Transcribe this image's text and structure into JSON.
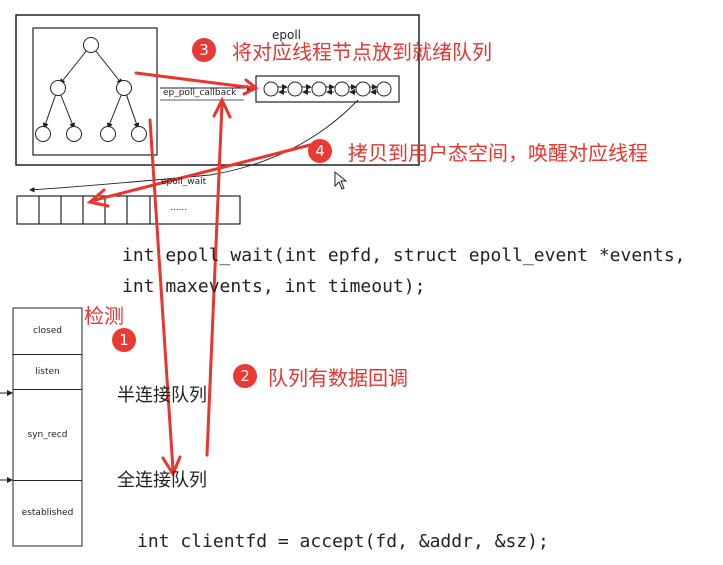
{
  "epoll_diagram": {
    "title": "epoll",
    "callback_label": "ep_poll_callback",
    "wait_label": "epoll_wait",
    "events_ellipsis": "......"
  },
  "code": {
    "line1": "int epoll_wait(int epfd, struct epoll_event *events,",
    "line2": "int maxevents, int timeout);",
    "accept_line": "int clientfd = accept(fd, &addr, &sz);"
  },
  "tcp_states": [
    "closed",
    "listen",
    "syn_recd",
    "established"
  ],
  "queues": {
    "half": "半连接队列",
    "full": "全连接队列"
  },
  "annotations": {
    "detect_label": "检测",
    "step1": "1",
    "step2": "2",
    "step2_text": "队列有数据回调",
    "step3": "3",
    "step3_text": "将对应线程节点放到就绪队列",
    "step4": "4",
    "step4_text": "拷贝到用户态空间，唤醒对应线程"
  },
  "colors": {
    "accent_red": "#e8352e",
    "line": "#222222"
  }
}
